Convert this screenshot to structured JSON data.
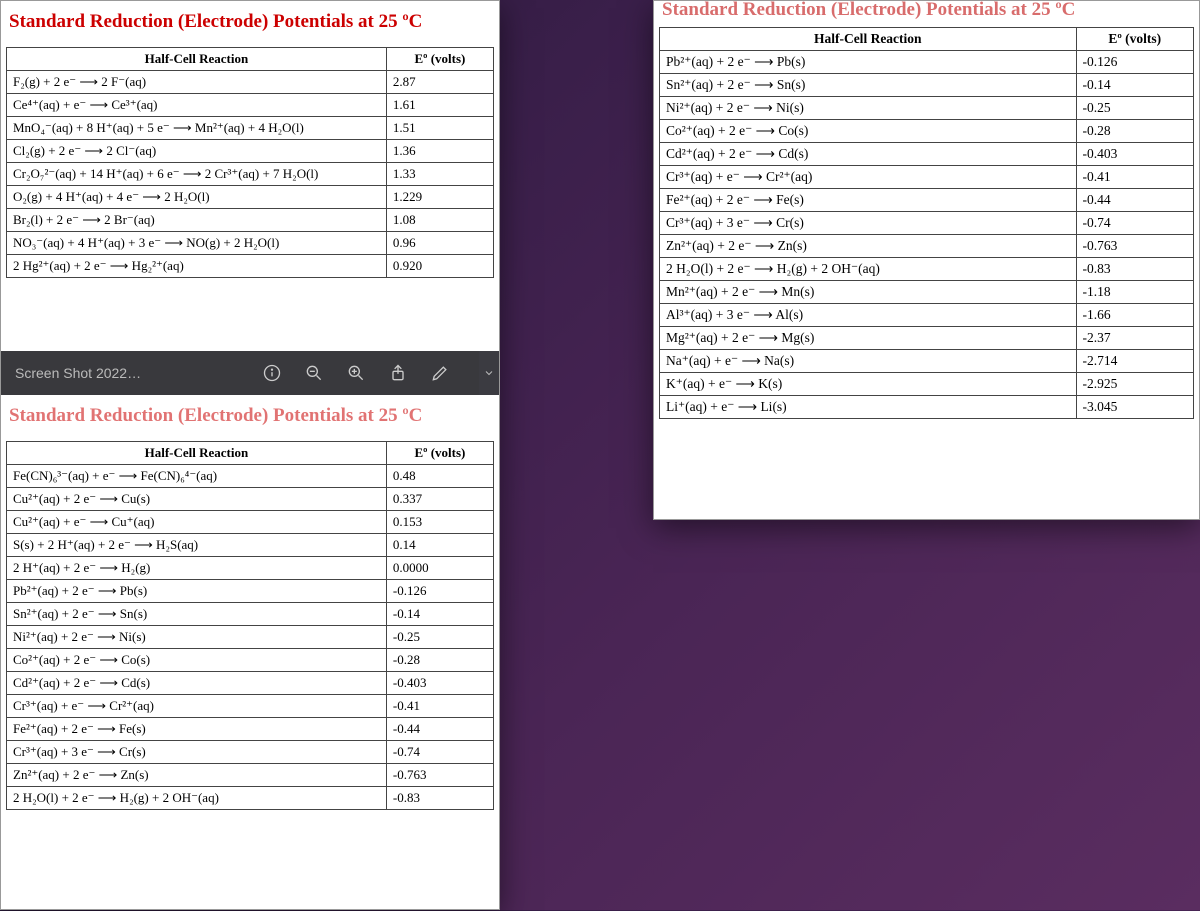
{
  "title": "Standard Reduction (Electrode) Potentials at 25 ºC",
  "headers": {
    "reaction": "Half-Cell Reaction",
    "potential": "Eº (volts)"
  },
  "toolbar": {
    "filename": "Screen Shot 2022…"
  },
  "segment_top": [
    {
      "rxn": "F₂(g) + 2 e⁻ ⟶ 2 F⁻(aq)",
      "e": "2.87"
    },
    {
      "rxn": "Ce⁴⁺(aq) + e⁻ ⟶ Ce³⁺(aq)",
      "e": "1.61"
    },
    {
      "rxn": "MnO₄⁻(aq) + 8 H⁺(aq) + 5 e⁻ ⟶ Mn²⁺(aq) + 4 H₂O(l)",
      "e": "1.51"
    },
    {
      "rxn": "Cl₂(g) + 2 e⁻ ⟶ 2 Cl⁻(aq)",
      "e": "1.36"
    },
    {
      "rxn": "Cr₂O₇²⁻(aq) + 14 H⁺(aq) + 6 e⁻ ⟶ 2 Cr³⁺(aq) + 7 H₂O(l)",
      "e": "1.33"
    },
    {
      "rxn": "O₂(g) + 4 H⁺(aq) + 4 e⁻ ⟶ 2 H₂O(l)",
      "e": "1.229"
    },
    {
      "rxn": "Br₂(l) + 2 e⁻ ⟶ 2 Br⁻(aq)",
      "e": "1.08"
    },
    {
      "rxn": "NO₃⁻(aq) + 4 H⁺(aq) + 3 e⁻ ⟶ NO(g) + 2 H₂O(l)",
      "e": "0.96"
    },
    {
      "rxn": "2 Hg²⁺(aq) + 2 e⁻ ⟶ Hg₂²⁺(aq)",
      "e": "0.920"
    }
  ],
  "segment_bot": [
    {
      "rxn": "Fe(CN)₆³⁻(aq) + e⁻ ⟶ Fe(CN)₆⁴⁻(aq)",
      "e": "0.48"
    },
    {
      "rxn": "Cu²⁺(aq) + 2 e⁻ ⟶ Cu(s)",
      "e": "0.337"
    },
    {
      "rxn": "Cu²⁺(aq) + e⁻ ⟶ Cu⁺(aq)",
      "e": "0.153"
    },
    {
      "rxn": "S(s) + 2 H⁺(aq) + 2 e⁻ ⟶ H₂S(aq)",
      "e": "0.14"
    },
    {
      "rxn": "2 H⁺(aq) + 2 e⁻ ⟶ H₂(g)",
      "e": "0.0000"
    },
    {
      "rxn": "Pb²⁺(aq) + 2 e⁻ ⟶ Pb(s)",
      "e": "-0.126"
    },
    {
      "rxn": "Sn²⁺(aq) + 2 e⁻ ⟶ Sn(s)",
      "e": "-0.14"
    },
    {
      "rxn": "Ni²⁺(aq) + 2 e⁻ ⟶ Ni(s)",
      "e": "-0.25"
    },
    {
      "rxn": "Co²⁺(aq) + 2 e⁻ ⟶ Co(s)",
      "e": "-0.28"
    },
    {
      "rxn": "Cd²⁺(aq) + 2 e⁻ ⟶ Cd(s)",
      "e": "-0.403"
    },
    {
      "rxn": "Cr³⁺(aq) + e⁻ ⟶ Cr²⁺(aq)",
      "e": "-0.41"
    },
    {
      "rxn": "Fe²⁺(aq) + 2 e⁻ ⟶ Fe(s)",
      "e": "-0.44"
    },
    {
      "rxn": "Cr³⁺(aq) + 3 e⁻ ⟶ Cr(s)",
      "e": "-0.74"
    },
    {
      "rxn": "Zn²⁺(aq) + 2 e⁻ ⟶ Zn(s)",
      "e": "-0.763"
    },
    {
      "rxn": "2 H₂O(l) + 2 e⁻ ⟶ H₂(g) + 2 OH⁻(aq)",
      "e": "-0.83"
    }
  ],
  "back_rows": [
    {
      "rxn": "Pb²⁺(aq) + 2 e⁻ ⟶ Pb(s)",
      "e": "-0.126"
    },
    {
      "rxn": "Sn²⁺(aq) + 2 e⁻ ⟶ Sn(s)",
      "e": "-0.14"
    },
    {
      "rxn": "Ni²⁺(aq) + 2 e⁻ ⟶ Ni(s)",
      "e": "-0.25"
    },
    {
      "rxn": "Co²⁺(aq) + 2 e⁻ ⟶ Co(s)",
      "e": "-0.28"
    },
    {
      "rxn": "Cd²⁺(aq) + 2 e⁻ ⟶ Cd(s)",
      "e": "-0.403"
    },
    {
      "rxn": "Cr³⁺(aq) + e⁻ ⟶ Cr²⁺(aq)",
      "e": "-0.41"
    },
    {
      "rxn": "Fe²⁺(aq) + 2 e⁻ ⟶ Fe(s)",
      "e": "-0.44"
    },
    {
      "rxn": "Cr³⁺(aq) + 3 e⁻ ⟶ Cr(s)",
      "e": "-0.74"
    },
    {
      "rxn": "Zn²⁺(aq) + 2 e⁻ ⟶ Zn(s)",
      "e": "-0.763"
    },
    {
      "rxn": "2 H₂O(l) + 2 e⁻ ⟶ H₂(g) + 2 OH⁻(aq)",
      "e": "-0.83"
    },
    {
      "rxn": "Mn²⁺(aq) + 2 e⁻ ⟶ Mn(s)",
      "e": "-1.18"
    },
    {
      "rxn": "Al³⁺(aq) + 3 e⁻ ⟶ Al(s)",
      "e": "-1.66"
    },
    {
      "rxn": "Mg²⁺(aq) + 2 e⁻ ⟶ Mg(s)",
      "e": "-2.37"
    },
    {
      "rxn": "Na⁺(aq) + e⁻ ⟶ Na(s)",
      "e": "-2.714"
    },
    {
      "rxn": "K⁺(aq) + e⁻ ⟶ K(s)",
      "e": "-2.925"
    },
    {
      "rxn": "Li⁺(aq) + e⁻ ⟶ Li(s)",
      "e": "-3.045"
    }
  ]
}
